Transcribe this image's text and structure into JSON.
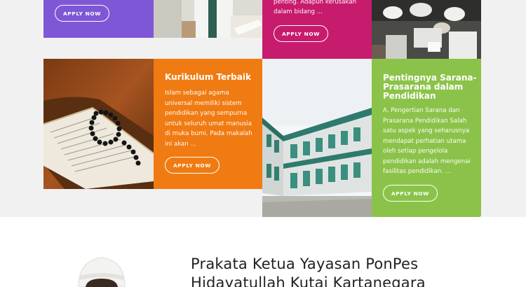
{
  "cards": {
    "purple": {
      "apply_label": "APPLY NOW",
      "color": "#7e57d6"
    },
    "magenta": {
      "desc_line1": "penting. Adapun kerusakan",
      "desc_line2": "dalam bidang ...",
      "apply_label": "APPLY NOW",
      "color": "#c71b6e"
    },
    "orange": {
      "title": "Kurikulum Terbaik",
      "desc": [
        "Islam sebagai agama",
        "universal memiliki sistem",
        "pendidikan yang sempurna",
        "untuk seluruh umat manusia",
        "di muka bumi. Pada makalah",
        "ini akan ..."
      ],
      "apply_label": "APPLY NOW",
      "color": "#f07b12"
    },
    "green": {
      "title_lines": [
        "Pentingnya Sarana-",
        "Prasarana dalam",
        "Pendidikan"
      ],
      "desc": [
        "A. Pengertian Sarana dan",
        "Prasarana Pendidikan Salah",
        "satu aspek yang seharusnya",
        "mendapat perhatian utama",
        "oleh setiap pengelola",
        "pendidikan adalah mengenai",
        "fasilitas pendidikan. ..."
      ],
      "apply_label": "APPLY NOW",
      "color": "#8bc34a"
    }
  },
  "prakata": {
    "title_line1": "Prakata Ketua Yayasan PonPes",
    "title_line2": "Hidayatullah Kutai Kartanegara"
  }
}
